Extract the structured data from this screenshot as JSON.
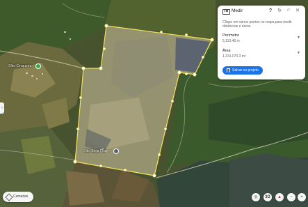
{
  "panel": {
    "title": "Medir",
    "description": "Clique em vários pontos no mapa para medir distâncias e áreas.",
    "perimeter_label": "Perímetro",
    "perimeter_value": "5,110,48 m",
    "area_label": "Área",
    "area_value": "1,331.070,3 m²",
    "save_label": "Salvar no projeto",
    "icons": {
      "measure": "ruler-icon",
      "help": "help-icon",
      "refresh": "refresh-icon",
      "undo": "undo-icon",
      "close": "close-icon"
    }
  },
  "map": {
    "places": [
      {
        "name": "Sítio Cerqueira"
      },
      {
        "name": "Sítio Beija Flor"
      }
    ],
    "colors": {
      "measure_line": "#f5e35a",
      "place_pin": "#34a853"
    }
  },
  "controls": {
    "layers_label": "Camadas",
    "view_3d_label": "3D"
  }
}
